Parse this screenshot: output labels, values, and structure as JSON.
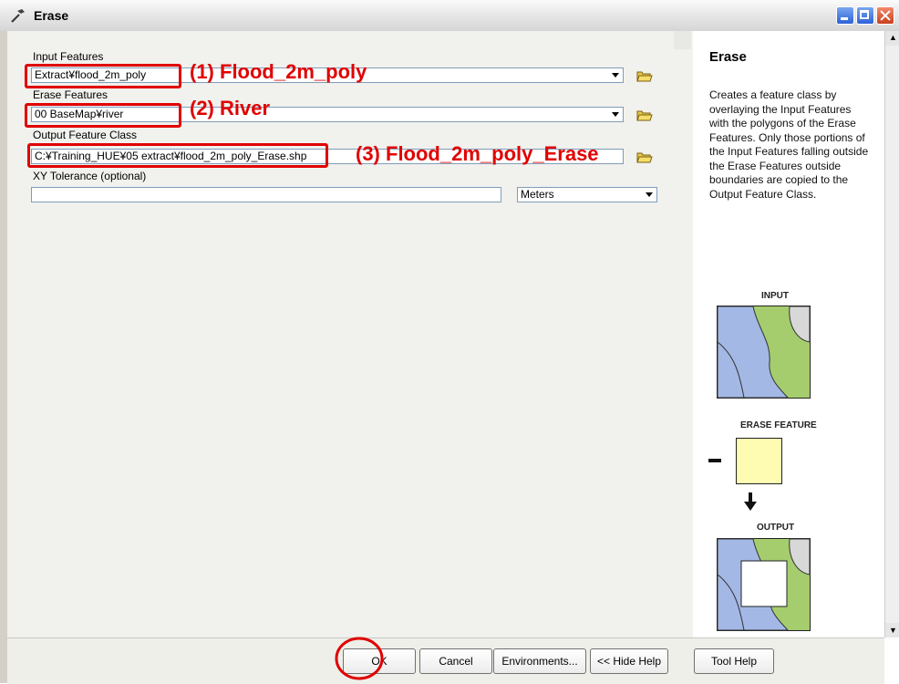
{
  "window": {
    "title": "Erase"
  },
  "form": {
    "input_features": {
      "label": "Input Features",
      "value": "Extract¥flood_2m_poly"
    },
    "erase_features": {
      "label": "Erase Features",
      "value": "00 BaseMap¥river"
    },
    "output_feature_class": {
      "label": "Output Feature Class",
      "value": "C:¥Training_HUE¥05 extract¥flood_2m_poly_Erase.shp"
    },
    "xy_tolerance": {
      "label": "XY Tolerance (optional)",
      "value": "",
      "units": "Meters"
    }
  },
  "annotations": {
    "a1": "(1)  Flood_2m_poly",
    "a2": "(2)  River",
    "a3": "(3)  Flood_2m_poly_Erase"
  },
  "help": {
    "title": "Erase",
    "body": "Creates a feature class by overlaying the Input Features with the polygons of the Erase Features. Only those portions of the Input Features falling outside the Erase Features outside boundaries are copied to the Output Feature Class.",
    "input_label": "INPUT",
    "erase_label": "ERASE FEATURE",
    "output_label": "OUTPUT"
  },
  "buttons": {
    "ok": "OK",
    "cancel": "Cancel",
    "environments": "Environments...",
    "hide_help": "<< Hide Help",
    "tool_help": "Tool Help"
  },
  "colors": {
    "annotation": "#e00000",
    "map_blue": "#a4b8e6",
    "map_green": "#a5cd6e",
    "erase_yellow": "#fdfcb2"
  }
}
